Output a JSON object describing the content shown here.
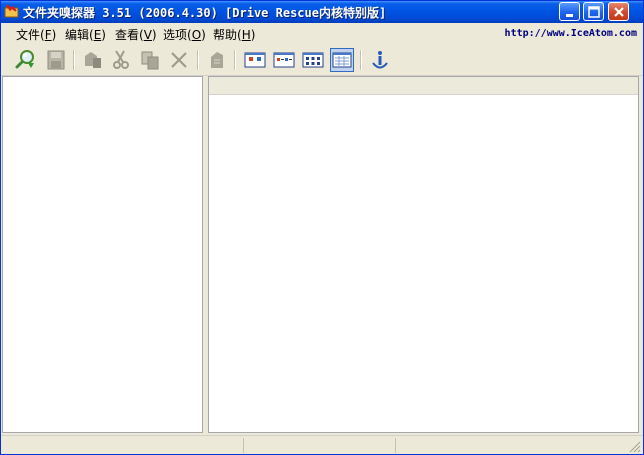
{
  "window": {
    "title": "文件夹嗅探器 3.51 (2006.4.30) [Drive Rescue内核特别版]",
    "app_icon": "folder-sniffer-app-icon",
    "controls": [
      {
        "name": "minimize-button",
        "icon": "minimize-icon"
      },
      {
        "name": "maximize-button",
        "icon": "maximize-icon"
      },
      {
        "name": "close-button",
        "icon": "close-icon"
      }
    ]
  },
  "menubar": {
    "items": [
      {
        "label": "文件",
        "accel": "(",
        "key": "F",
        "end": ")"
      },
      {
        "label": "编辑",
        "accel": "(",
        "key": "E",
        "end": ")"
      },
      {
        "label": "查看",
        "accel": "(",
        "key": "V",
        "end": ")"
      },
      {
        "label": "选项",
        "accel": "(",
        "key": "O",
        "end": ")"
      },
      {
        "label": "帮助",
        "accel": "(",
        "key": "H",
        "end": ")"
      }
    ],
    "url": "http://www.IceAtom.com"
  },
  "toolbar": {
    "tools": [
      {
        "icon": "scan-search-icon",
        "enabled": true
      },
      {
        "icon": "save-icon",
        "enabled": false
      },
      {
        "icon": "restore-icon",
        "enabled": false
      },
      {
        "icon": "cut-icon",
        "enabled": false
      },
      {
        "icon": "copy-icon",
        "enabled": false
      },
      {
        "icon": "delete-icon",
        "enabled": false
      },
      {
        "icon": "paste-icon",
        "enabled": false
      },
      {
        "icon": "large-icons-view-icon",
        "enabled": true
      },
      {
        "icon": "small-icons-view-icon",
        "enabled": true
      },
      {
        "icon": "list-view-icon",
        "enabled": true
      },
      {
        "icon": "details-view-icon",
        "enabled": true,
        "active": true
      },
      {
        "icon": "about-info-icon",
        "enabled": true
      }
    ]
  },
  "colors": {
    "titlebar": "#0054e3",
    "face": "#ece9d8",
    "active_tool_bg": "#c1d2ee",
    "active_tool_border": "#316ac5",
    "url_text": "#000080"
  }
}
